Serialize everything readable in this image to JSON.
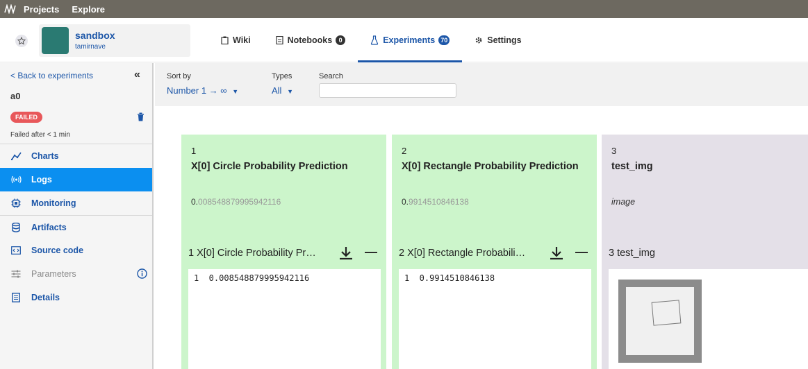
{
  "topbar": {
    "projects": "Projects",
    "explore": "Explore"
  },
  "project": {
    "name": "sandbox",
    "owner": "tamirnave"
  },
  "tabs": [
    {
      "label": "Wiki",
      "icon": "clipboard-icon"
    },
    {
      "label": "Notebooks",
      "icon": "notebook-icon",
      "badge": "0"
    },
    {
      "label": "Experiments",
      "icon": "flask-icon",
      "badge": "70",
      "active": true
    },
    {
      "label": "Settings",
      "icon": "gear-icon"
    }
  ],
  "sidebar": {
    "back": "< Back to experiments",
    "experiment_name": "a0",
    "status": "FAILED",
    "status_text": "Failed after < 1 min",
    "items": [
      {
        "label": "Charts",
        "icon": "line-chart-icon"
      },
      {
        "label": "Logs",
        "icon": "signal-icon",
        "active": true
      },
      {
        "label": "Monitoring",
        "icon": "cpu-icon"
      },
      {
        "label": "Artifacts",
        "icon": "database-icon"
      },
      {
        "label": "Source code",
        "icon": "code-icon"
      },
      {
        "label": "Parameters",
        "icon": "sliders-icon",
        "disabled": true
      },
      {
        "label": "Details",
        "icon": "document-icon"
      }
    ]
  },
  "filters": {
    "sort_label": "Sort by",
    "sort_value": "Number 1 → ∞",
    "types_label": "Types",
    "types_value": "All",
    "search_label": "Search",
    "search_value": ""
  },
  "logs": [
    {
      "number": "1",
      "title": "X[0] Circle Probability Prediction",
      "value_int": "0.",
      "value_frac": "008548879995942116",
      "channel_header": "1  X[0] Circle Probability Pr…",
      "log_line": "1  0.008548879995942116",
      "type": "numeric",
      "color": "#ccf5cb"
    },
    {
      "number": "2",
      "title": "X[0] Rectangle Probability Prediction",
      "value_int": "0.",
      "value_frac": "9914510846138",
      "channel_header": "2  X[0] Rectangle Probabili…",
      "log_line": "1  0.9914510846138",
      "type": "numeric",
      "color": "#ccf5cb"
    },
    {
      "number": "3",
      "title": "test_img",
      "value_label": "image",
      "channel_header": "3  test_img",
      "type": "image",
      "color": "#e4e0e8"
    }
  ]
}
